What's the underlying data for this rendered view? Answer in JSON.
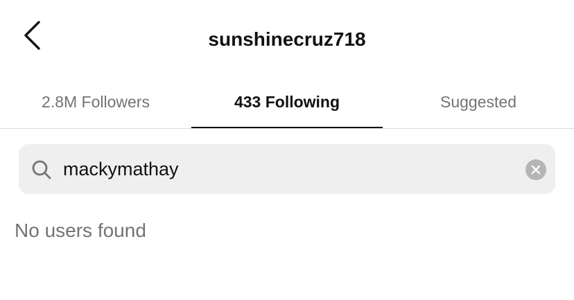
{
  "header": {
    "back_icon": "chevron-left-icon",
    "title": "sunshinecruz718"
  },
  "tabs": [
    {
      "label": "2.8M Followers",
      "active": false
    },
    {
      "label": "433 Following",
      "active": true
    },
    {
      "label": "Suggested",
      "active": false
    }
  ],
  "search": {
    "icon": "search-icon",
    "value": "mackymathay",
    "clear_icon": "clear-icon"
  },
  "results": {
    "empty_message": "No users found"
  },
  "colors": {
    "text_primary": "#111111",
    "text_secondary": "#737373",
    "search_bg": "#efefef",
    "divider": "#dbdbdb",
    "clear_bg": "#b5b5b5"
  }
}
